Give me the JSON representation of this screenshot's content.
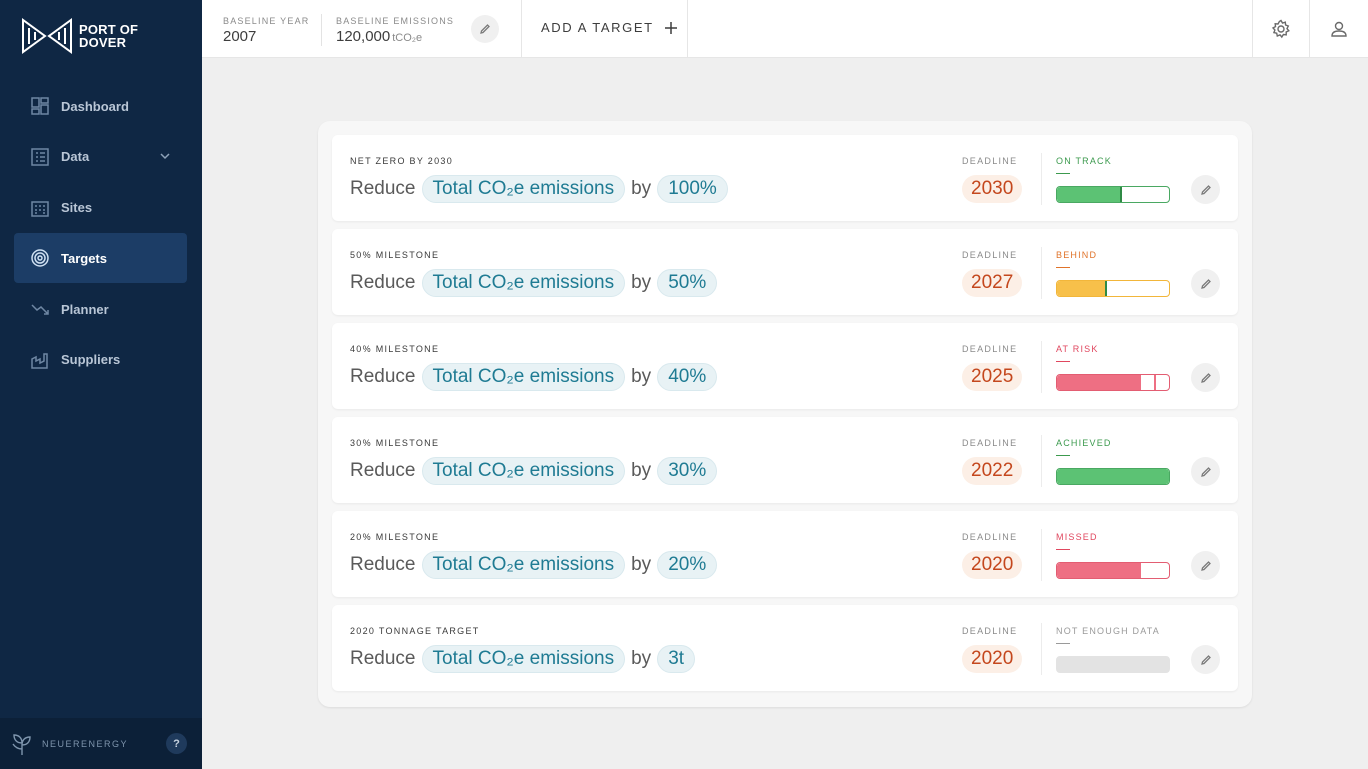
{
  "app": {
    "logo_text_line1": "PORT OF",
    "logo_text_line2": "DOVER",
    "brand": "NEUERENERGY",
    "help": "?"
  },
  "sidebar": {
    "items": [
      {
        "label": "Dashboard",
        "icon": "dashboard-icon",
        "active": false
      },
      {
        "label": "Data",
        "icon": "data-icon",
        "active": false,
        "expandable": true
      },
      {
        "label": "Sites",
        "icon": "sites-icon",
        "active": false
      },
      {
        "label": "Targets",
        "icon": "target-icon",
        "active": true
      },
      {
        "label": "Planner",
        "icon": "planner-icon",
        "active": false
      },
      {
        "label": "Suppliers",
        "icon": "suppliers-icon",
        "active": false
      }
    ]
  },
  "topbar": {
    "baseline_year_label": "BASELINE YEAR",
    "baseline_year_value": "2007",
    "baseline_emissions_label": "BASELINE EMISSIONS",
    "baseline_emissions_value": "120,000",
    "baseline_emissions_unit": "tCO₂e",
    "add_target_label": "ADD A TARGET"
  },
  "targets": [
    {
      "title": "NET ZERO BY 2030",
      "verb": "Reduce",
      "metric": "Total CO₂e emissions",
      "by": "by",
      "amount": "100%",
      "deadline_label": "DEADLINE",
      "deadline": "2030",
      "status": "ON TRACK",
      "status_color": "#3c9a4e",
      "progress": 0.56,
      "marker": 0.56,
      "fill_color": "#5cc274"
    },
    {
      "title": "50% MILESTONE",
      "verb": "Reduce",
      "metric": "Total CO₂e emissions",
      "by": "by",
      "amount": "50%",
      "deadline_label": "DEADLINE",
      "deadline": "2027",
      "status": "BEHIND",
      "status_color": "#e0732a",
      "progress": 0.43,
      "marker": 0.43,
      "fill_color": "#f7c04a"
    },
    {
      "title": "40% MILESTONE",
      "verb": "Reduce",
      "metric": "Total CO₂e emissions",
      "by": "by",
      "amount": "40%",
      "deadline_label": "DEADLINE",
      "deadline": "2025",
      "status": "AT RISK",
      "status_color": "#e0475f",
      "progress": 0.75,
      "marker": 0.87,
      "fill_color": "#ee6f83"
    },
    {
      "title": "30% MILESTONE",
      "verb": "Reduce",
      "metric": "Total CO₂e emissions",
      "by": "by",
      "amount": "30%",
      "deadline_label": "DEADLINE",
      "deadline": "2022",
      "status": "ACHIEVED",
      "status_color": "#3c9a4e",
      "progress": 1.0,
      "marker": null,
      "fill_color": "#5cc274"
    },
    {
      "title": "20% MILESTONE",
      "verb": "Reduce",
      "metric": "Total CO₂e emissions",
      "by": "by",
      "amount": "20%",
      "deadline_label": "DEADLINE",
      "deadline": "2020",
      "status": "MISSED",
      "status_color": "#e0475f",
      "progress": 0.75,
      "marker": null,
      "fill_color": "#ee6f83"
    },
    {
      "title": "2020 TONNAGE TARGET",
      "verb": "Reduce",
      "metric": "Total CO₂e emissions",
      "by": "by",
      "amount": "3t",
      "deadline_label": "DEADLINE",
      "deadline": "2020",
      "status": "NOT ENOUGH DATA",
      "status_color": "#9a9a9a",
      "progress": 0,
      "marker": null,
      "fill_color": "#e3e3e3"
    }
  ]
}
